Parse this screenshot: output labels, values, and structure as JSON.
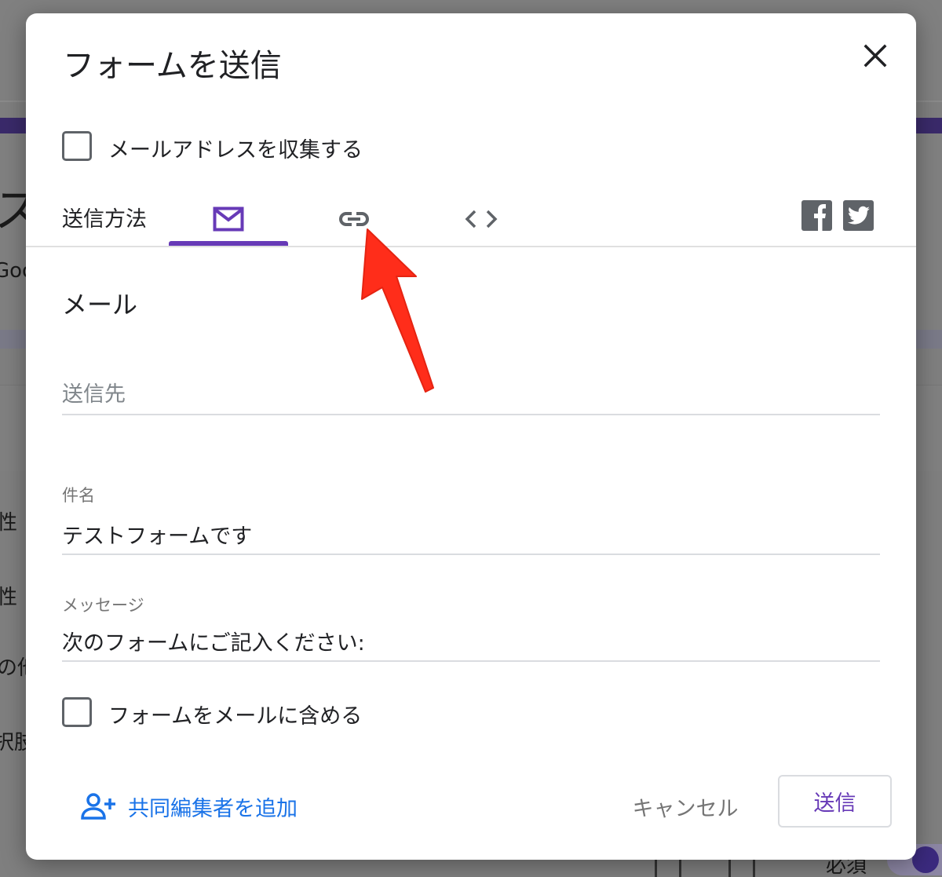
{
  "background": {
    "fragments": [
      "ス",
      "Goo",
      "性",
      "性",
      "の他",
      "択肢",
      "必須"
    ]
  },
  "dialog": {
    "title": "フォームを送信",
    "collect_email_label": "メールアドレスを収集する",
    "send_via_label": "送信方法",
    "tabs": [
      {
        "icon": "mail-icon",
        "active": true
      },
      {
        "icon": "link-icon",
        "active": false
      },
      {
        "icon": "embed-code-icon",
        "active": false
      }
    ],
    "share": [
      "facebook-icon",
      "twitter-icon"
    ],
    "section_title": "メール",
    "to_field": {
      "placeholder": "送信先",
      "value": ""
    },
    "subject_field": {
      "label": "件名",
      "value": "テストフォームです"
    },
    "message_field": {
      "label": "メッセージ",
      "value": "次のフォームにご記入ください:"
    },
    "include_form_label": "フォームをメールに含める",
    "add_collaborators_label": "共同編集者を追加",
    "cancel_label": "キャンセル",
    "send_label": "送信"
  },
  "colors": {
    "accent": "#673ab7",
    "link": "#1a73e8",
    "annotation_arrow": "#ff2d1a"
  }
}
